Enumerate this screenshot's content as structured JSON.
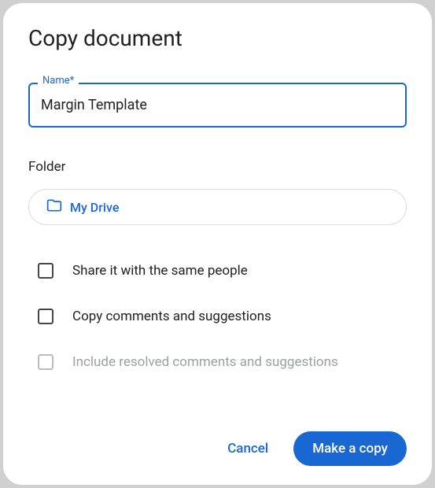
{
  "dialog": {
    "title": "Copy document",
    "name_field": {
      "label": "Name",
      "required_mark": "*",
      "value": "Margin Template"
    },
    "folder_section": {
      "label": "Folder",
      "chip_label": "My Drive"
    },
    "options": {
      "share_same": "Share it with the same people",
      "copy_comments": "Copy comments and suggestions",
      "include_resolved": "Include resolved comments and suggestions"
    },
    "actions": {
      "cancel": "Cancel",
      "confirm": "Make a copy"
    }
  }
}
